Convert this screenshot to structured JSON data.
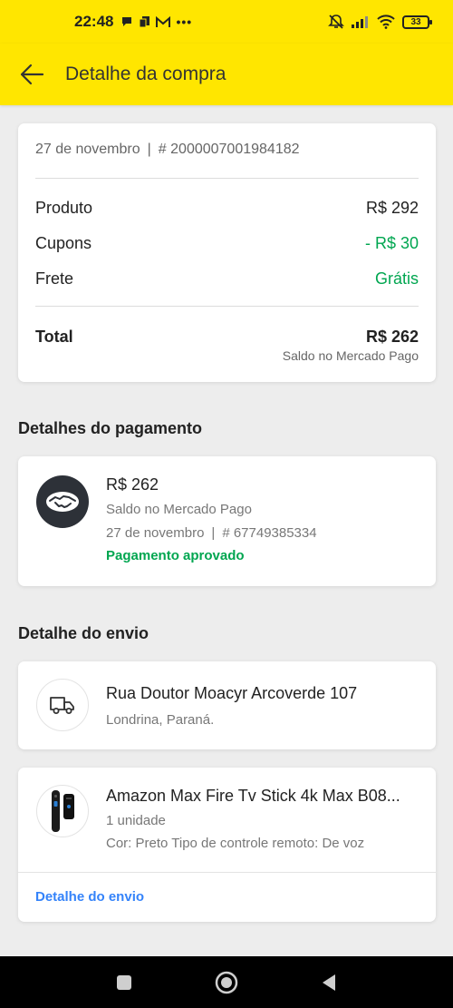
{
  "status_bar": {
    "time": "22:48",
    "battery": "33"
  },
  "header": {
    "title": "Detalhe da compra"
  },
  "summary": {
    "date": "27 de novembro",
    "separator": "|",
    "order_number": "# 2000007001984182",
    "rows": [
      {
        "label": "Produto",
        "value": "R$ 292"
      },
      {
        "label": "Cupons",
        "value": "- R$ 30"
      },
      {
        "label": "Frete",
        "value": "Grátis"
      }
    ],
    "total_label": "Total",
    "total_value": "R$ 262",
    "total_method": "Saldo no Mercado Pago"
  },
  "payment": {
    "section_title": "Detalhes do pagamento",
    "amount": "R$ 262",
    "method": "Saldo no Mercado Pago",
    "date": "27 de novembro",
    "separator": "|",
    "operation_number": "# 67749385334",
    "status": "Pagamento aprovado"
  },
  "shipping": {
    "section_title": "Detalhe do envio",
    "address": "Rua Doutor Moacyr Arcoverde 107",
    "city": "Londrina, Paraná.",
    "product_title": "Amazon Max Fire Tv Stick 4k Max B08...",
    "quantity": "1 unidade",
    "variation": "Cor: Preto Tipo de controle remoto: De voz",
    "link": "Detalhe do envio"
  },
  "colors": {
    "brand_yellow": "#ffe600",
    "success_green": "#00a650",
    "link_blue": "#3483fa",
    "avatar_dark": "#2d3138"
  },
  "icons": {
    "back": "arrow-left-icon",
    "payment": "handshake-icon",
    "delivery": "truck-icon",
    "nav_recents": "square-icon",
    "nav_home": "circle-icon",
    "nav_back": "triangle-back-icon"
  }
}
